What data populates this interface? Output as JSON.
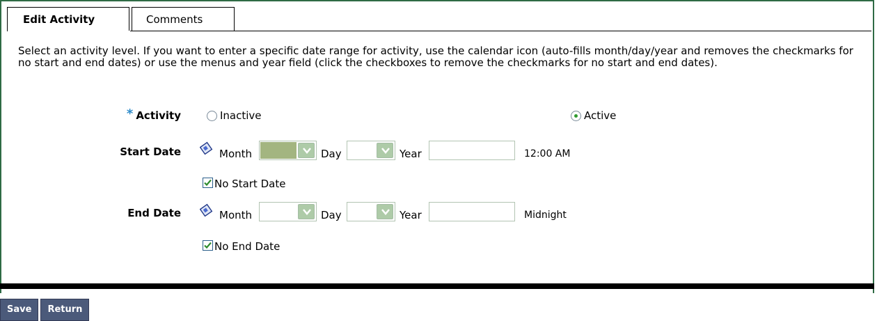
{
  "tabs": [
    {
      "label": "Edit Activity",
      "active": true
    },
    {
      "label": "Comments",
      "active": false
    }
  ],
  "instructions": "Select an activity level. If you want to enter a specific date range for activity, use the calendar icon (auto-fills month/day/year and removes the checkmarks for no start and end dates) or use the menus and year field (click the checkboxes to remove the checkmarks for no start and end dates).",
  "activity": {
    "required_marker": "*",
    "label": "Activity",
    "options": [
      {
        "label": "Inactive",
        "selected": false
      },
      {
        "label": "Active",
        "selected": true
      }
    ]
  },
  "start_date": {
    "label": "Start Date",
    "month_label": "Month",
    "month_value": "",
    "day_label": "Day",
    "day_value": "",
    "year_label": "Year",
    "year_value": "",
    "time": "12:00 AM",
    "no_date_label": "No Start Date",
    "no_date_checked": true
  },
  "end_date": {
    "label": "End Date",
    "month_label": "Month",
    "month_value": "",
    "day_label": "Day",
    "day_value": "",
    "year_label": "Year",
    "year_value": "",
    "time": "Midnight",
    "no_date_label": "No End Date",
    "no_date_checked": true
  },
  "buttons": {
    "save": "Save",
    "return": "Return"
  },
  "colors": {
    "panel_border": "#2f6b45",
    "required": "#2e8bc9",
    "button_bg": "#4b5a7a",
    "dropdown_arrow": "#aecba8",
    "radio_selected": "#2f9a2f"
  }
}
